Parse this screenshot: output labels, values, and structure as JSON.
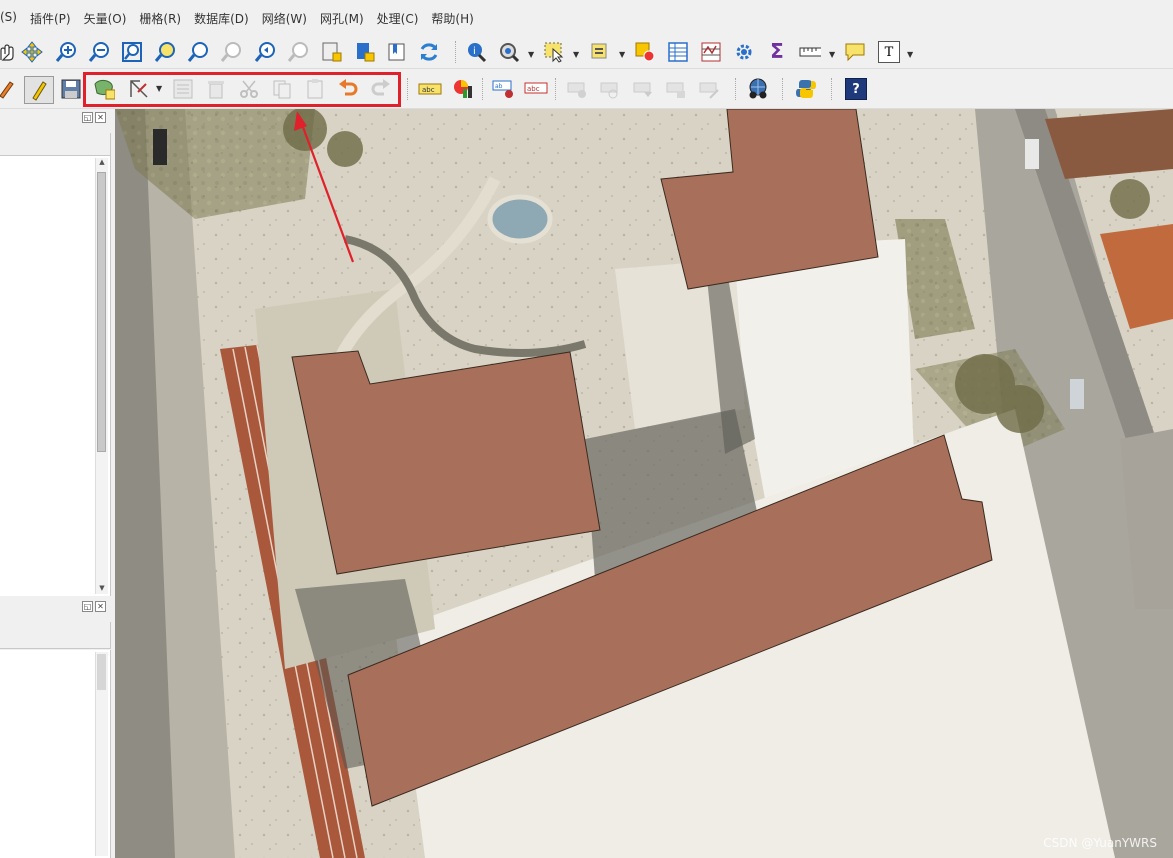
{
  "menu": {
    "items": [
      "(S)",
      "插件(P)",
      "矢量(O)",
      "栅格(R)",
      "数据库(D)",
      "网络(W)",
      "网孔(M)",
      "处理(C)",
      "帮助(H)"
    ]
  },
  "toolbar1": {
    "icons": [
      "pan-icon",
      "pan-to-selection-icon",
      "zoom-in-icon",
      "zoom-out-icon",
      "zoom-full-icon",
      "zoom-to-selection-icon",
      "zoom-to-layer-icon",
      "zoom-native-icon",
      "zoom-last-icon",
      "zoom-next-icon",
      "new-bookmark-icon",
      "show-bookmarks-icon",
      "map-tips-icon",
      "refresh-icon",
      "identify-icon",
      "select-by-location-icon",
      "select-features-icon",
      "deselect-icon",
      "attribute-table-icon",
      "field-calculator-icon",
      "settings-icon",
      "statistics-icon",
      "measure-icon",
      "annotation-icon",
      "text-annotation-icon"
    ],
    "sum_symbol": "Σ",
    "text_symbol": "T"
  },
  "toolbar2": {
    "edit_group_label": "digitizing-toolbar",
    "label_abc": "abc",
    "help_symbol": "?"
  },
  "map": {
    "polygon_fill": "#a8705a",
    "polygon_stroke": "#3a2a20"
  },
  "watermark": "CSDN @YuanYWRS",
  "colors": {
    "highlight": "#e0202a",
    "arrow": "#e0202a"
  }
}
